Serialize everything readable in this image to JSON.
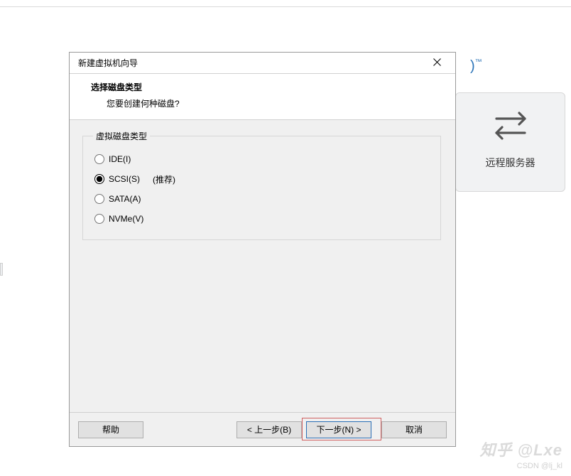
{
  "background": {
    "card_label": "远程服务器",
    "trademark_text": ")",
    "trademark_sup": "™"
  },
  "dialog": {
    "title": "新建虚拟机向导",
    "header": {
      "title": "选择磁盘类型",
      "subtitle": "您要创建何种磁盘?"
    },
    "group_legend": "虚拟磁盘类型",
    "options": [
      {
        "id": "ide",
        "label": "IDE(I)",
        "hint": "",
        "checked": false
      },
      {
        "id": "scsi",
        "label": "SCSI(S)",
        "hint": "(推荐)",
        "checked": true
      },
      {
        "id": "sata",
        "label": "SATA(A)",
        "hint": "",
        "checked": false
      },
      {
        "id": "nvme",
        "label": "NVMe(V)",
        "hint": "",
        "checked": false
      }
    ],
    "buttons": {
      "help": "帮助",
      "back": "< 上一步(B)",
      "next": "下一步(N) >",
      "cancel": "取消"
    }
  },
  "watermark": {
    "zhihu": "知乎 @Lxe",
    "csdn": "CSDN @lj_kl"
  }
}
